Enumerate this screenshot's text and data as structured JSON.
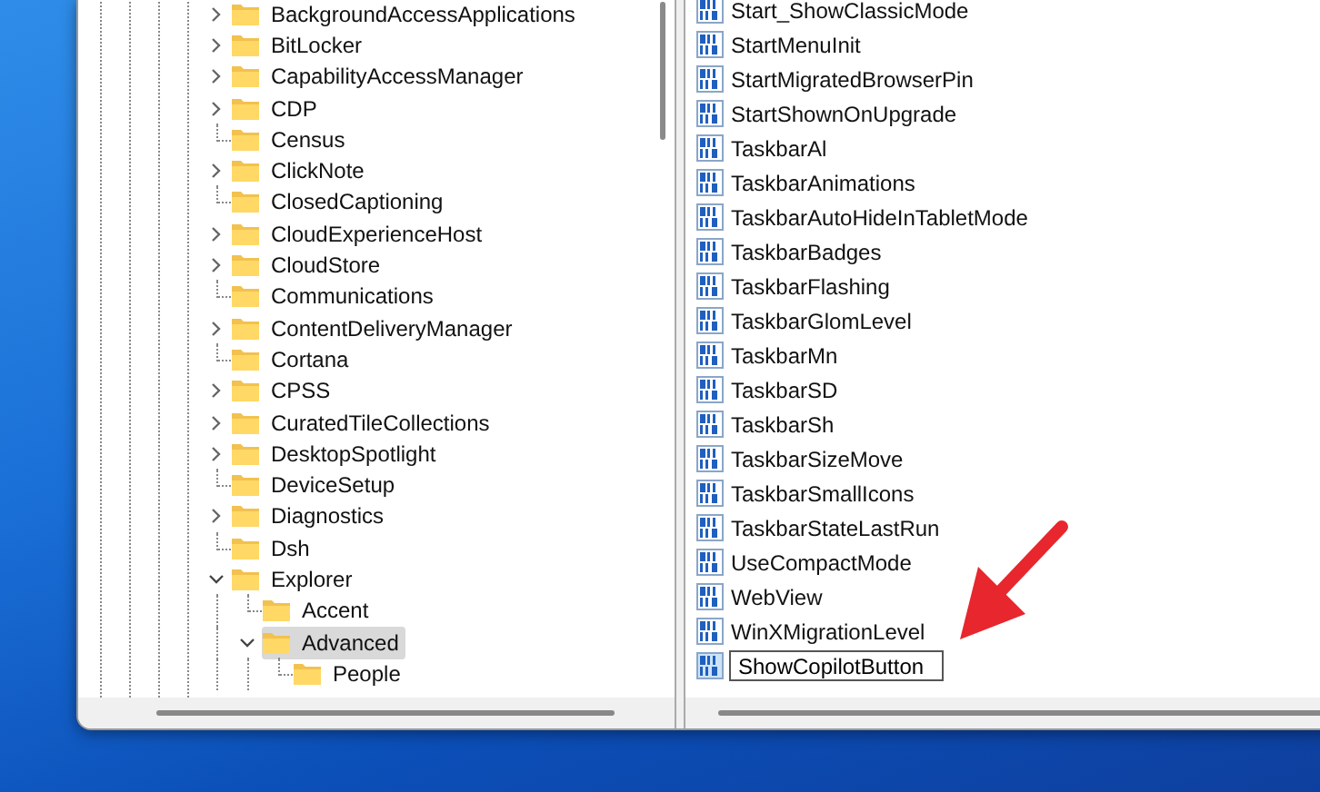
{
  "tree": {
    "items": [
      {
        "label": "BackgroundAccessApplications",
        "kind": "branch",
        "expanded": false,
        "selected": false
      },
      {
        "label": "BitLocker",
        "kind": "branch",
        "expanded": false,
        "selected": false
      },
      {
        "label": "CapabilityAccessManager",
        "kind": "branch",
        "expanded": false,
        "selected": false
      },
      {
        "label": "CDP",
        "kind": "branch",
        "expanded": false,
        "selected": false
      },
      {
        "label": "Census",
        "kind": "leaf",
        "selected": false
      },
      {
        "label": "ClickNote",
        "kind": "branch",
        "expanded": false,
        "selected": false
      },
      {
        "label": "ClosedCaptioning",
        "kind": "leaf",
        "selected": false
      },
      {
        "label": "CloudExperienceHost",
        "kind": "branch",
        "expanded": false,
        "selected": false
      },
      {
        "label": "CloudStore",
        "kind": "branch",
        "expanded": false,
        "selected": false
      },
      {
        "label": "Communications",
        "kind": "leaf",
        "selected": false
      },
      {
        "label": "ContentDeliveryManager",
        "kind": "branch",
        "expanded": false,
        "selected": false
      },
      {
        "label": "Cortana",
        "kind": "leaf",
        "selected": false
      },
      {
        "label": "CPSS",
        "kind": "branch",
        "expanded": false,
        "selected": false
      },
      {
        "label": "CuratedTileCollections",
        "kind": "branch",
        "expanded": false,
        "selected": false
      },
      {
        "label": "DesktopSpotlight",
        "kind": "branch",
        "expanded": false,
        "selected": false
      },
      {
        "label": "DeviceSetup",
        "kind": "leaf",
        "selected": false
      },
      {
        "label": "Diagnostics",
        "kind": "branch",
        "expanded": false,
        "selected": false
      },
      {
        "label": "Dsh",
        "kind": "leaf",
        "selected": false
      },
      {
        "label": "Explorer",
        "kind": "branch",
        "expanded": true,
        "selected": false,
        "children": [
          {
            "label": "Accent",
            "kind": "leaf",
            "selected": false
          },
          {
            "label": "Advanced",
            "kind": "branch",
            "expanded": true,
            "selected": true,
            "children": [
              {
                "label": "People",
                "kind": "leaf",
                "selected": false
              }
            ]
          }
        ]
      }
    ]
  },
  "values": {
    "items": [
      {
        "name": "Start_ShowClassicMode",
        "editing": false
      },
      {
        "name": "StartMenuInit",
        "editing": false
      },
      {
        "name": "StartMigratedBrowserPin",
        "editing": false
      },
      {
        "name": "StartShownOnUpgrade",
        "editing": false
      },
      {
        "name": "TaskbarAl",
        "editing": false
      },
      {
        "name": "TaskbarAnimations",
        "editing": false
      },
      {
        "name": "TaskbarAutoHideInTabletMode",
        "editing": false
      },
      {
        "name": "TaskbarBadges",
        "editing": false
      },
      {
        "name": "TaskbarFlashing",
        "editing": false
      },
      {
        "name": "TaskbarGlomLevel",
        "editing": false
      },
      {
        "name": "TaskbarMn",
        "editing": false
      },
      {
        "name": "TaskbarSD",
        "editing": false
      },
      {
        "name": "TaskbarSh",
        "editing": false
      },
      {
        "name": "TaskbarSizeMove",
        "editing": false
      },
      {
        "name": "TaskbarSmallIcons",
        "editing": false
      },
      {
        "name": "TaskbarStateLastRun",
        "editing": false
      },
      {
        "name": "UseCompactMode",
        "editing": false
      },
      {
        "name": "WebView",
        "editing": false
      },
      {
        "name": "WinXMigrationLevel",
        "editing": false
      },
      {
        "name": "ShowCopilotButton",
        "editing": true
      }
    ]
  }
}
